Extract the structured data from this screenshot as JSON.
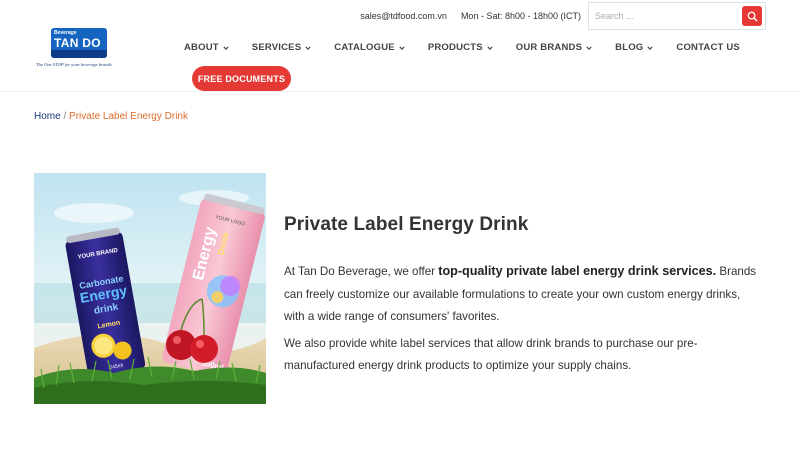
{
  "topbar": {
    "email": "sales@tdfood.com.vn",
    "hours": "Mon - Sat: 8h00 - 18h00 (ICT)"
  },
  "search": {
    "placeholder": "Search ..."
  },
  "logo": {
    "small_text": "Beverage",
    "brand": "TAN DO",
    "tagline": "The One STOP for your beverage brands"
  },
  "nav": {
    "items": [
      {
        "label": "ABOUT",
        "has_dropdown": true
      },
      {
        "label": "SERVICES",
        "has_dropdown": true
      },
      {
        "label": "CATALOGUE",
        "has_dropdown": true
      },
      {
        "label": "PRODUCTS",
        "has_dropdown": true
      },
      {
        "label": "OUR BRANDS",
        "has_dropdown": true
      },
      {
        "label": "BLOG",
        "has_dropdown": true
      },
      {
        "label": "CONTACT US",
        "has_dropdown": false
      }
    ],
    "cta_label": "FREE DOCUMENTS"
  },
  "breadcrumb": {
    "home": "Home",
    "separator": " / ",
    "current": "Private Label Energy Drink"
  },
  "product_image": {
    "can1_brand": "YOUR BRAND",
    "can1_line1": "Carbonate",
    "can1_line2": "Energy",
    "can1_line3": "drink",
    "can1_flavor": "Lemon",
    "can1_volume": "245ml",
    "can2_brand": "YOUR LOGO",
    "can2_line1": "Energy",
    "can2_line2": "Drink",
    "can2_volume": "500ml"
  },
  "main": {
    "title": "Private Label Energy Drink",
    "p1_intro": "At Tan Do Beverage, we offer ",
    "p1_bold": "top-quality private label energy drink services.",
    "p1_rest": " Brands can freely customize our available formulations to create your own custom energy drinks, with a wide range of consumers' favorites.",
    "p2": "We also provide white label services that allow drink brands to purchase our pre-manufactured energy drink products to optimize your supply chains."
  },
  "colors": {
    "accent": "#e53935",
    "brand_blue": "#1a3a7a",
    "breadcrumb_current": "#e06a2c"
  }
}
